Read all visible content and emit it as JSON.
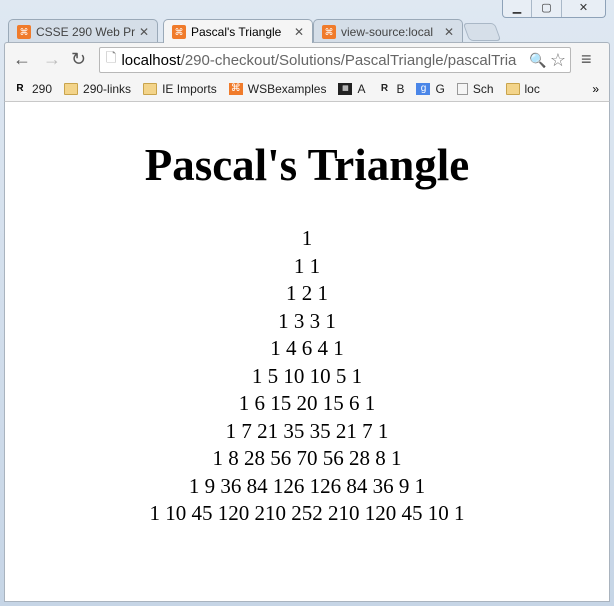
{
  "window": {
    "controls": [
      "minimize",
      "maximize",
      "close"
    ]
  },
  "tabs": [
    {
      "title": "CSSE 290 Web Pro",
      "active": false
    },
    {
      "title": "Pascal's Triangle",
      "active": true
    },
    {
      "title": "view-source:local",
      "active": false
    }
  ],
  "address": {
    "host": "localhost",
    "path": "/290-checkout/Solutions/PascalTriangle/pascalTria"
  },
  "bookmarks": [
    {
      "label": "290",
      "icon": "r-logo-icon"
    },
    {
      "label": "290-links",
      "icon": "folder-icon"
    },
    {
      "label": "IE Imports",
      "icon": "folder-icon"
    },
    {
      "label": "WSBexamples",
      "icon": "xampp-icon"
    },
    {
      "label": "A",
      "icon": "film-icon"
    },
    {
      "label": "B",
      "icon": "r-logo-icon"
    },
    {
      "label": "G",
      "icon": "google-icon"
    },
    {
      "label": "Sch",
      "icon": "page-icon"
    },
    {
      "label": "loc",
      "icon": "folder-icon"
    }
  ],
  "overflow": "»",
  "page": {
    "title": "Pascal's Triangle",
    "rows": [
      "1",
      "1 1",
      "1 2 1",
      "1 3 3 1",
      "1 4 6 4 1",
      "1 5 10 10 5 1",
      "1 6 15 20 15 6 1",
      "1 7 21 35 35 21 7 1",
      "1 8 28 56 70 56 28 8 1",
      "1 9 36 84 126 126 84 36 9 1",
      "1 10 45 120 210 252 210 120 45 10 1"
    ]
  }
}
